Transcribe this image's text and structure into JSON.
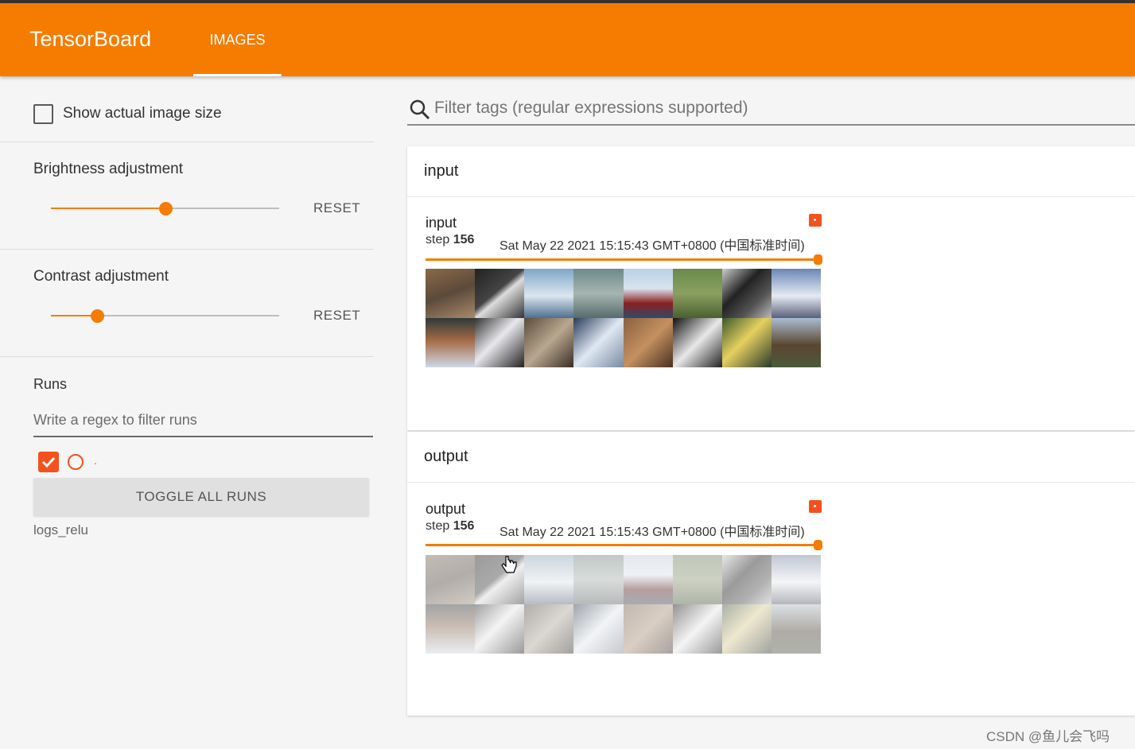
{
  "app": {
    "title": "TensorBoard",
    "tabs": [
      {
        "label": "IMAGES",
        "active": true
      }
    ],
    "accent_color": "#f57c00"
  },
  "sidebar": {
    "show_actual_size_label": "Show actual image size",
    "show_actual_size_checked": false,
    "brightness": {
      "label": "Brightness adjustment",
      "reset_label": "RESET",
      "value_fraction": 0.5
    },
    "contrast": {
      "label": "Contrast adjustment",
      "reset_label": "RESET",
      "value_fraction": 0.2
    },
    "runs": {
      "label": "Runs",
      "filter_placeholder": "Write a regex to filter runs",
      "run_list": [
        {
          "label": ".",
          "checked": true,
          "color": "#f4511e"
        }
      ],
      "toggle_all_label": "TOGGLE ALL RUNS",
      "run_dir": "logs_relu"
    }
  },
  "main": {
    "filter_placeholder": "Filter tags (regular expressions supported)",
    "cards": [
      {
        "title": "input",
        "image": {
          "tag": "input",
          "step_label": "step",
          "step": "156",
          "wall_time": "Sat May 22 2021 15:15:43 GMT+0800 (中国标准时间)"
        }
      },
      {
        "title": "output",
        "image": {
          "tag": "output",
          "step_label": "step",
          "step": "156",
          "wall_time": "Sat May 22 2021 15:15:43 GMT+0800 (中国标准时间)"
        }
      }
    ]
  },
  "watermark": "CSDN @鱼儿会飞吗"
}
